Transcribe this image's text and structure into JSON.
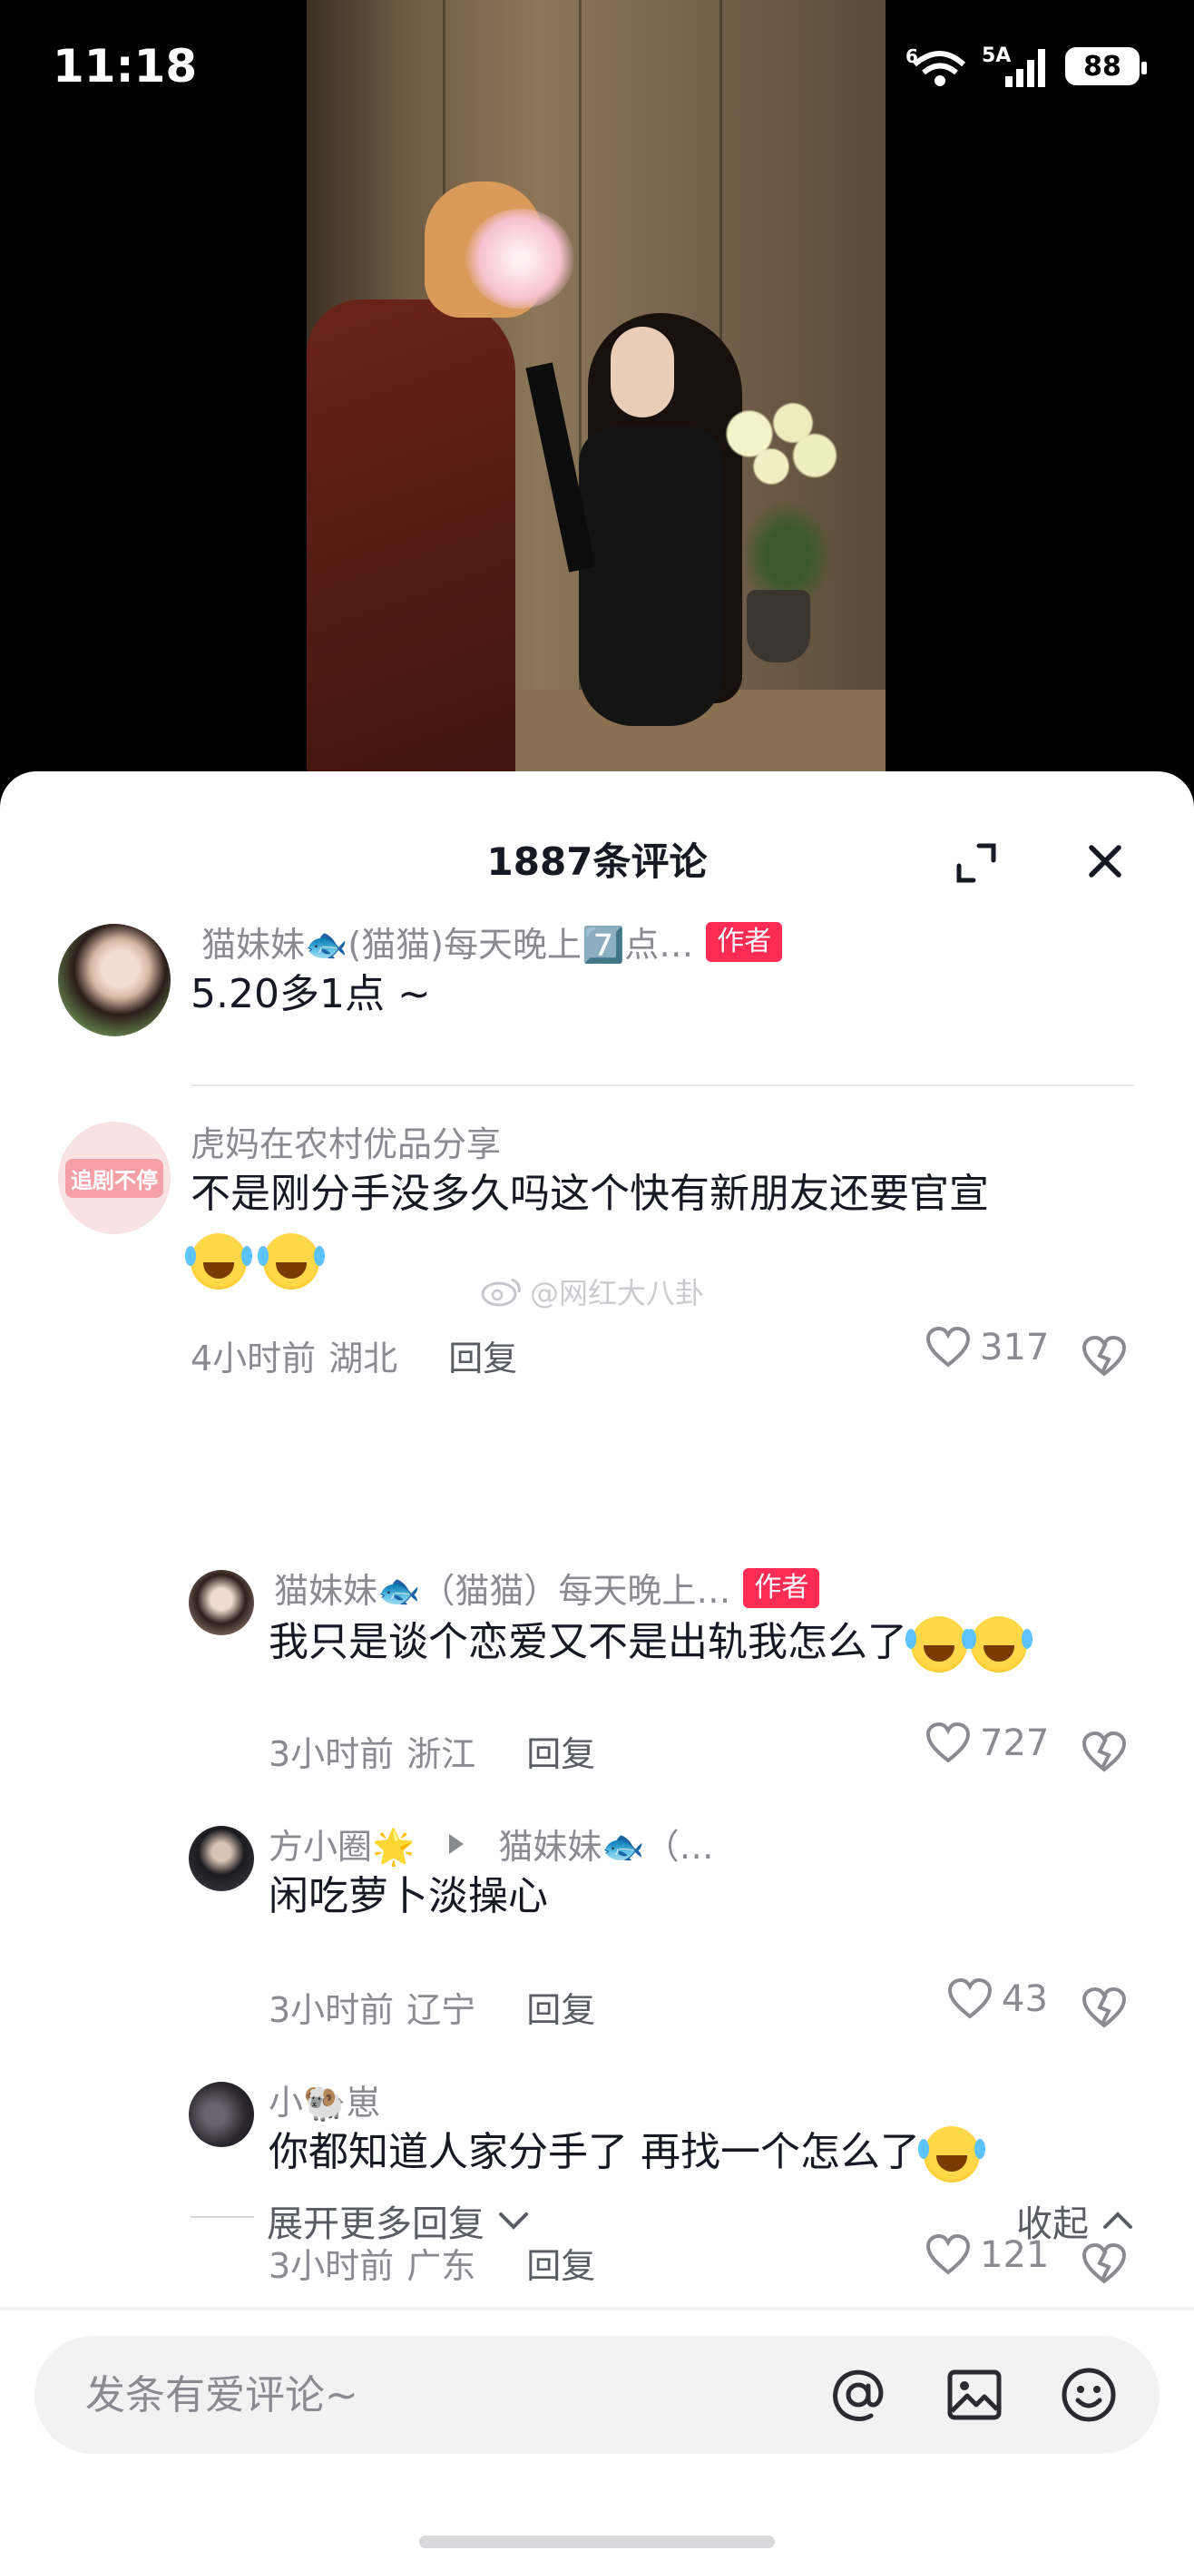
{
  "status_bar": {
    "time": "11:18",
    "battery": "88",
    "signal_label": "5A",
    "wifi_label": "6"
  },
  "sheet": {
    "title": "1887条评论"
  },
  "comments": [
    {
      "name": "猫妹妹🐟(猫猫)每天晚上7️⃣点…",
      "tag": "作者",
      "text": "5.20多1点 ~"
    },
    {
      "name": "虎妈在农村优品分享",
      "avatar_text": "追剧不停",
      "text": "不是刚分手没多久吗这个快有新朋友还要官宣",
      "time": "4小时前",
      "location": "湖北",
      "reply": "回复",
      "likes": "317"
    }
  ],
  "replies": [
    {
      "name": "猫妹妹🐟（猫猫）每天晚上…",
      "tag": "作者",
      "text": "我只是谈个恋爱又不是出轨我怎么了",
      "time": "3小时前",
      "location": "浙江",
      "reply": "回复",
      "likes": "727"
    },
    {
      "name": "方小圈🌟",
      "target": "猫妹妹🐟（…",
      "text": "闲吃萝卜淡操心",
      "time": "3小时前",
      "location": "辽宁",
      "reply": "回复",
      "likes": "43"
    },
    {
      "name": "小🐏崽",
      "text": "你都知道人家分手了 再找一个怎么了",
      "time": "3小时前",
      "location": "广东",
      "reply": "回复",
      "likes": "121"
    }
  ],
  "watermark": "@网红大八卦",
  "expand_more": "展开更多回复",
  "collapse": "收起",
  "input": {
    "placeholder": "发条有爱评论~"
  },
  "colors": {
    "accent": "#fe2c55",
    "text_primary": "#161823",
    "text_secondary": "#8a8b91"
  }
}
